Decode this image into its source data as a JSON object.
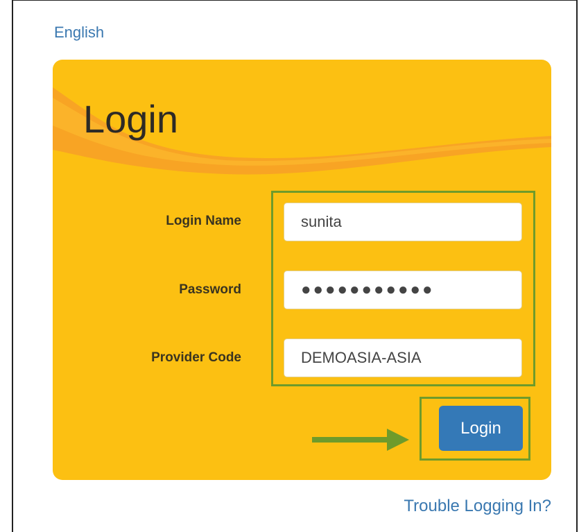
{
  "header": {
    "language_link": "English"
  },
  "card": {
    "title": "Login",
    "fields": {
      "login_name": {
        "label": "Login Name",
        "value": "sunita"
      },
      "password": {
        "label": "Password",
        "value": "●●●●●●●●●●●"
      },
      "provider_code": {
        "label": "Provider Code",
        "value": "DEMOASIA-ASIA"
      }
    },
    "submit_label": "Login"
  },
  "footer": {
    "trouble_link": "Trouble Logging In?"
  },
  "colors": {
    "card_background": "#fcc012",
    "wave_accent": "#f7a127",
    "highlight_border": "#6e9b2b",
    "button": "#3479b7",
    "link": "#3a78b0"
  },
  "icons": {
    "annotation_arrow": "arrow-right-icon"
  }
}
